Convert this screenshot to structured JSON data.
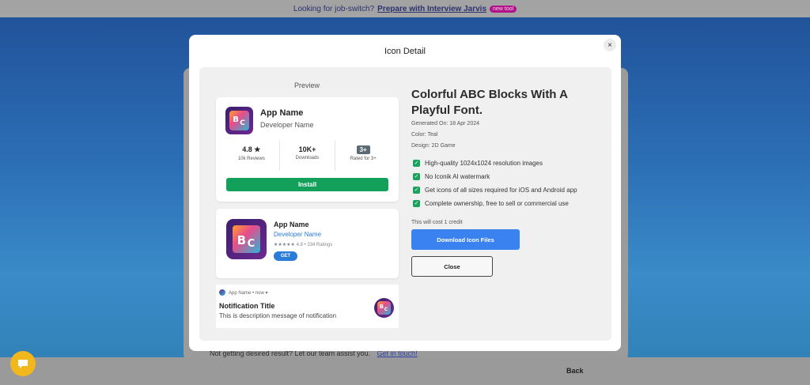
{
  "banner": {
    "text": "Looking for job-switch?",
    "link": "Prepare with Interview Jarvis",
    "badge": "new tool"
  },
  "modal": {
    "title": "Icon Detail",
    "close_icon": "×",
    "preview_label": "Preview",
    "card1": {
      "app_name": "App Name",
      "developer": "Developer Name",
      "stats": [
        {
          "value": "4.8 ★",
          "label": "10k Reviews"
        },
        {
          "value": "10K+",
          "label": "Downloads"
        },
        {
          "value": "3+",
          "label": "Rated for 3+"
        }
      ],
      "install_label": "Install"
    },
    "card2": {
      "app_name": "App Name",
      "developer": "Developer Name",
      "stars": "★★★★★",
      "rating_text": "4.8 • 334 Ratings",
      "get_label": "GET"
    },
    "notification": {
      "header": "App Name • now ▾",
      "title": "Notification Title",
      "message": "This is description message of notification"
    },
    "details": {
      "title": "Colorful ABC Blocks With A Playful Font.",
      "generated_on": "Generated On: 18 Apr 2024",
      "color": "Color: Teal",
      "design": "Design: 2D Game",
      "features": [
        "High-quality 1024x1024 resolution images",
        "No Iconik AI watermark",
        "Get icons of all sizes required for iOS and Android app",
        "Complete ownership, free to sell or commercial use"
      ],
      "cost_text": "This will cost 1 credit",
      "download_label": "Download Icon Files",
      "close_label": "Close"
    }
  },
  "footer": {
    "text": "Not getting desired result? Let our team assist you.",
    "link": "Get in touch!",
    "back_label": "Back"
  },
  "colors": {
    "install": "#13a05a",
    "download": "#3a82ef",
    "check": "#1aa35c",
    "chat": "#f2b71d"
  }
}
